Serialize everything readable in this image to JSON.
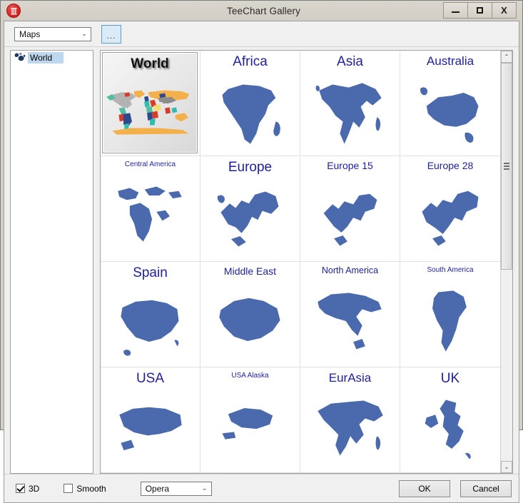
{
  "window": {
    "title": "TeeChart Gallery",
    "app_icon": "teechart-app-icon",
    "controls": {
      "minimize": "minimize-button",
      "maximize": "maximize-button",
      "close_label": "X"
    }
  },
  "toolbar": {
    "category_combo": {
      "value": "Maps",
      "arrow": "⌄"
    },
    "more_button_label": "..."
  },
  "tree": {
    "items": [
      {
        "label": "World",
        "icon": "world-map-icon",
        "selected": true
      }
    ]
  },
  "gallery": {
    "selected": "World",
    "tiles": [
      {
        "label": "World",
        "size": "xl",
        "art": "world",
        "selected": true
      },
      {
        "label": "Africa",
        "size": "xl",
        "art": "africa",
        "selected": false
      },
      {
        "label": "Asia",
        "size": "xl",
        "art": "asia",
        "selected": false
      },
      {
        "label": "Australia",
        "size": "lg",
        "art": "australia",
        "selected": false
      },
      {
        "label": "Central America",
        "size": "xs",
        "art": "centralamerica",
        "selected": false
      },
      {
        "label": "Europe",
        "size": "xl",
        "art": "europe",
        "selected": false
      },
      {
        "label": "Europe 15",
        "size": "md",
        "art": "europe15",
        "selected": false
      },
      {
        "label": "Europe 28",
        "size": "md",
        "art": "europe28",
        "selected": false
      },
      {
        "label": "Spain",
        "size": "xl",
        "art": "spain",
        "selected": false
      },
      {
        "label": "Middle East",
        "size": "md",
        "art": "middleeast",
        "selected": false
      },
      {
        "label": "North America",
        "size": "sm",
        "art": "northamerica",
        "selected": false
      },
      {
        "label": "South America",
        "size": "xs",
        "art": "southamerica",
        "selected": false
      },
      {
        "label": "USA",
        "size": "xl",
        "art": "usa",
        "selected": false
      },
      {
        "label": "USA Alaska",
        "size": "xs",
        "art": "usaalaska",
        "selected": false
      },
      {
        "label": "EurAsia",
        "size": "lg",
        "art": "eurasia",
        "selected": false
      },
      {
        "label": "UK",
        "size": "xl",
        "art": "uk",
        "selected": false
      }
    ]
  },
  "scrollbar": {
    "up_arrow": "⌃",
    "down_arrow": "⌄"
  },
  "footer": {
    "threed_label": "3D",
    "threed_checked": true,
    "smooth_label": "Smooth",
    "smooth_checked": false,
    "theme_combo": {
      "value": "Opera",
      "arrow": "⌄"
    },
    "ok_label": "OK",
    "cancel_label": "Cancel"
  },
  "colors": {
    "map_blue": "#4a6aad",
    "caption_blue": "#1f1f9e",
    "accent_focus": "#5b9bd5",
    "selection_blue": "#bdd7ee",
    "window_chrome": "#d4d0c8"
  }
}
